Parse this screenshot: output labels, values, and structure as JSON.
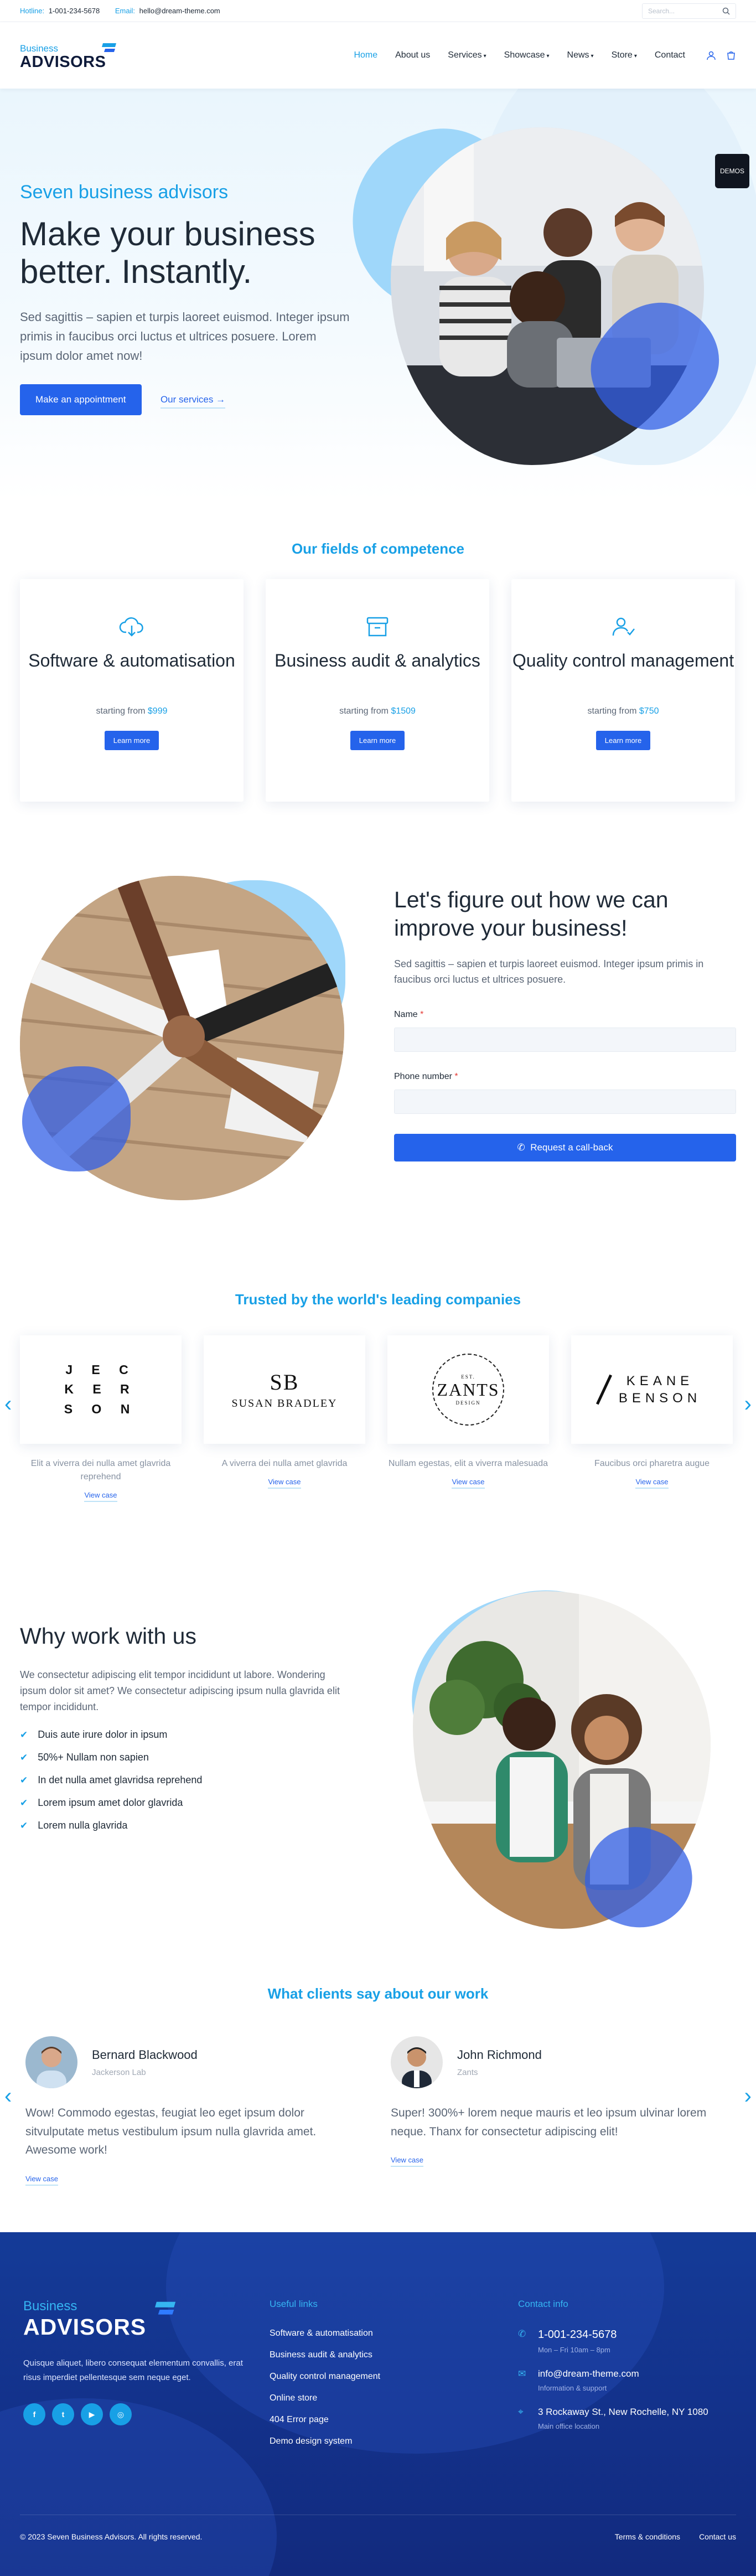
{
  "topbar": {
    "hotline_label": "Hotline:",
    "hotline_value": "1-001-234-5678",
    "email_label": "Email:",
    "email_value": "hello@dream-theme.com",
    "search_placeholder": "Search..."
  },
  "header": {
    "logo_line1": "Business",
    "logo_line2": "ADVISORS",
    "nav": [
      {
        "label": "Home",
        "active": true
      },
      {
        "label": "About us"
      },
      {
        "label": "Services"
      },
      {
        "label": "Showcase"
      },
      {
        "label": "News"
      },
      {
        "label": "Store"
      },
      {
        "label": "Contact"
      }
    ],
    "caret": "▾"
  },
  "hero": {
    "eyebrow": "Seven business advisors",
    "title": "Make your business better. Instantly.",
    "lead": "Sed sagittis – sapien et turpis laoreet euismod. Integer ipsum primis in faucibus orci luctus et ultrices posuere. Lorem ipsum dolor amet now!",
    "primary_cta": "Make an appointment",
    "secondary_cta": "Our services",
    "demos_badge": "DEMOS"
  },
  "competence": {
    "title": "Our fields of competence",
    "cards": [
      {
        "icon": "cloud-download-icon",
        "title": "Software & automatisation",
        "price_label": "starting from",
        "price": "$999",
        "button": "Learn more"
      },
      {
        "icon": "archive-box-icon",
        "title": "Business audit & analytics",
        "price_label": "starting from",
        "price": "$1509",
        "button": "Learn more"
      },
      {
        "icon": "user-check-icon",
        "title": "Quality control management",
        "price_label": "starting from",
        "price": "$750",
        "button": "Learn more"
      }
    ]
  },
  "callback": {
    "title": "Let's figure out how we can improve your business!",
    "text": "Sed sagittis – sapien et turpis laoreet euismod. Integer ipsum primis in faucibus orci luctus et ultrices posuere.",
    "name_label": "Name",
    "phone_label": "Phone number",
    "required_mark": "*",
    "button": "Request a call-back"
  },
  "trusted": {
    "title": "Trusted by the world's leading companies",
    "logos": [
      {
        "name": "JECKERSON",
        "lines": [
          "J E C",
          "K E R",
          "S O N"
        ],
        "desc": "Elit a viverra dei nulla amet glavrida reprehend",
        "link": "View case"
      },
      {
        "name": "SUSAN BRADLEY",
        "monogram": "SB",
        "wordmark": "SUSAN BRADLEY",
        "desc": "A viverra dei nulla amet glavrida",
        "link": "View case"
      },
      {
        "name": "ZANTS",
        "top": "EST.",
        "wordmark": "ZANTS",
        "bottom": "DESIGN",
        "desc": "Nullam egestas, elit a viverra malesuada",
        "link": "View case"
      },
      {
        "name": "KEANE BENSON",
        "line1": "KEANE",
        "line2": "BENSON",
        "desc": "Faucibus orci pharetra augue",
        "link": "View case"
      }
    ],
    "prev": "‹",
    "next": "›"
  },
  "why": {
    "title": "Why work with us",
    "text": "We consectetur adipiscing elit tempor incididunt ut labore. Wondering ipsum dolor sit amet? We consectetur adipiscing ipsum nulla glavrida elit tempor incididunt.",
    "items": [
      "Duis aute irure dolor in ipsum",
      "50%+ Nullam non sapien",
      "In det nulla amet glavridsa reprehend",
      "Lorem ipsum amet dolor glavrida",
      "Lorem nulla glavrida"
    ]
  },
  "testimonials": {
    "title": "What clients say about our work",
    "items": [
      {
        "name": "Bernard Blackwood",
        "company": "Jackerson Lab",
        "quote": "Wow! Commodo egestas, feugiat leo eget ipsum dolor sitvulputate metus vestibulum ipsum nulla glavrida amet. Awesome work!",
        "link": "View case"
      },
      {
        "name": "John Richmond",
        "company": "Zants",
        "quote": "Super! 300%+ lorem neque mauris et leo ipsum ulvinar lorem neque. Thanx for consectetur adipiscing elit!",
        "link": "View case"
      }
    ]
  },
  "footer": {
    "logo_line1": "Business",
    "logo_line2": "ADVISORS",
    "desc": "Quisque aliquet, libero consequat elementum convallis, erat risus imperdiet pellentesque sem neque eget.",
    "social": [
      {
        "icon": "facebook-icon",
        "glyph": "f"
      },
      {
        "icon": "twitter-icon",
        "glyph": "t"
      },
      {
        "icon": "youtube-icon",
        "glyph": "▶"
      },
      {
        "icon": "instagram-icon",
        "glyph": "◎"
      }
    ],
    "useful_title": "Useful links",
    "useful_links": [
      "Software & automatisation",
      "Business audit & analytics",
      "Quality control management",
      "Online store",
      "404 Error page",
      "Demo design system"
    ],
    "contact_title": "Contact info",
    "phone": "1-001-234-5678",
    "phone_sub": "Mon – Fri 10am – 8pm",
    "email": "info@dream-theme.com",
    "email_sub": "Information & support",
    "address": "3 Rockaway St., New Rochelle, NY 1080",
    "address_sub": "Main office location",
    "copyright": "© 2023 Seven Business Advisors. All rights reserved.",
    "bottom_links": [
      "Terms & conditions",
      "Contact us"
    ]
  },
  "colors": {
    "accent": "#18a0e6",
    "primary": "#2563eb",
    "footer_bg": "#13318a"
  }
}
